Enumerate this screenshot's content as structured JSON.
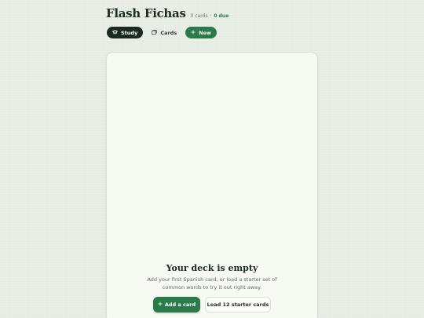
{
  "header": {
    "title": "Flash Fichas",
    "card_count": "0 cards",
    "separator": "·",
    "due": "0 due"
  },
  "nav": {
    "study": {
      "label": "Study",
      "icon": "graduation-cap-icon"
    },
    "cards": {
      "label": "Cards",
      "icon": "cards-icon"
    },
    "new": {
      "label": "New",
      "icon": "plus-icon"
    }
  },
  "empty_state": {
    "title": "Your deck is empty",
    "description": "Add your first Spanish card, or load a starter set of common words to try it out right away.",
    "add_button": "Add a card",
    "add_icon": "plus-icon",
    "starter_button": "Load 12 starter cards"
  },
  "colors": {
    "accent": "#2b7a4b",
    "dark": "#1b2a20",
    "background": "#e9efe6",
    "card": "#f6faf3"
  }
}
